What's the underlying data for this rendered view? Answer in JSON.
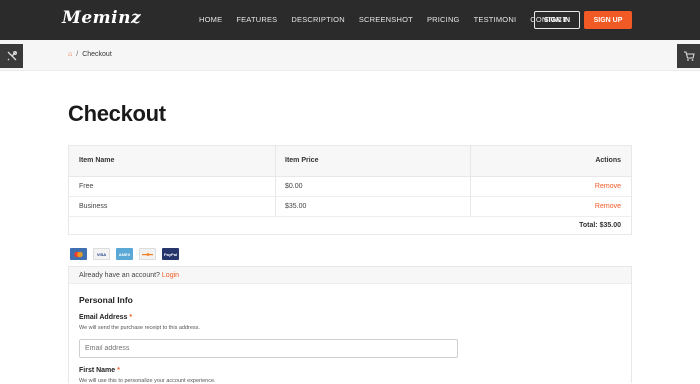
{
  "brand": {
    "logo": "Meminz"
  },
  "nav": {
    "items": [
      "HOME",
      "FEATURES",
      "DESCRIPTION",
      "SCREENSHOT",
      "PRICING",
      "TESTIMONI",
      "CONTACT"
    ]
  },
  "auth": {
    "signin": "SIGN IN",
    "signup": "SIGN UP"
  },
  "breadcrumb": {
    "separator": "/",
    "current": "Checkout"
  },
  "page": {
    "title": "Checkout"
  },
  "table": {
    "headers": [
      "Item Name",
      "Item Price",
      "Actions"
    ],
    "rows": [
      {
        "name": "Free",
        "price": "$0.00",
        "action": "Remove"
      },
      {
        "name": "Business",
        "price": "$35.00",
        "action": "Remove"
      }
    ],
    "total": "Total: $35.00"
  },
  "payment_cards": [
    {
      "icon": "mastercard-icon",
      "color": "#3f6fb0"
    },
    {
      "icon": "visa-icon",
      "label": "VISA",
      "color": "#f3f3f3"
    },
    {
      "icon": "amex-icon",
      "label": "AMEX",
      "color": "#5aa8d6"
    },
    {
      "icon": "discover-icon",
      "color": "#f2f2f2"
    },
    {
      "icon": "paypal-icon",
      "label": "PayPal",
      "color": "#26356b"
    }
  ],
  "account": {
    "prompt": "Already have an account?",
    "login": "Login"
  },
  "form": {
    "section_title": "Personal Info",
    "email_label": "Email Address",
    "required": "*",
    "email_hint": "We will send the purchase receipt to this address.",
    "email_placeholder": "Email address",
    "first_name_label": "First Name",
    "first_name_hint": "We will use this to personalize your account experience."
  },
  "colors": {
    "accent": "#f15a24",
    "topbar": "#2b2b2b"
  }
}
